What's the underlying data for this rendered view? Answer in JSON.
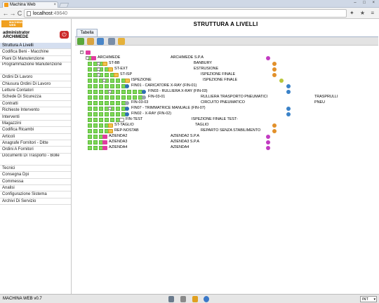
{
  "browser": {
    "tab_title": "Machina Web",
    "close_glyph": "×",
    "window_controls": "– □ ×",
    "back_glyph": "←",
    "forward_glyph": "→",
    "reload_glyph": "C",
    "url_host": "localhost",
    "url_port": ":49640",
    "extension_glyphs": "✦ ★ ≡"
  },
  "app": {
    "logo_text": "MACHINA WEB",
    "user_line1": "administrator",
    "user_line2": "ARCHIMEDE",
    "logout_glyph": "⏻",
    "version": "MACHINA WEB v0.7",
    "language": "INT",
    "language_caret": "▾"
  },
  "menu": [
    "Struttura A Livelli",
    "Codifica Beni - Macchine",
    "Piani Di Manutenzione",
    "Programmazione Manutenzione",
    "Ordini Di Lavoro",
    "Chiusura Ordini Di Lavoro",
    "Letture Contatori",
    "Schede Di Sicurezza",
    "Contratti",
    "Richieste Intervento",
    "Interventi",
    "Magazzini",
    "Codifica Ricambi",
    "Articoli",
    "Anagrafe Fornitori - Ditte",
    "Ordini A Fornitori",
    "Documenti Di Trasporto - Bolle",
    "Tecnici",
    "Consegna Dpi",
    "Commessa",
    "Analisi",
    "Configurazione Sistema",
    "Archivi Di Servizio"
  ],
  "main": {
    "title": "STRUTTURA A LIVELLI",
    "subtab": "Tabella"
  },
  "tree": [
    {
      "code": "",
      "desc": "",
      "extra": "",
      "extra2": "",
      "icon": "mag",
      "dot": ""
    },
    {
      "code": "ARCHIMEDE",
      "desc": "ARCHIMEDE S.P.A",
      "extra": "",
      "extra2": "",
      "icon": "mag",
      "dot": "mag"
    },
    {
      "code": "ST-BB",
      "desc": "BANBURY",
      "extra": "",
      "extra2": "",
      "icon": "yel",
      "dot": "org"
    },
    {
      "code": "ST-EXT",
      "desc": "ESTRUSIONE",
      "extra": "",
      "extra2": "",
      "icon": "yel",
      "dot": "org"
    },
    {
      "code": "ST-ISP",
      "desc": "ISPEZIONE FINALE",
      "extra": "",
      "extra2": "",
      "icon": "yel",
      "dot": "org"
    },
    {
      "code": "ISPEZIONE",
      "desc": "ISPEZIONE FINALE",
      "extra": "",
      "extra2": "",
      "icon": "yel",
      "dot": "grn"
    },
    {
      "code": "FIN01 - CARICATORE X-RAY (FIN-01)",
      "desc": "",
      "extra": "",
      "extra2": "",
      "icon": "blu",
      "dot": "blu"
    },
    {
      "code": "FIN03 - RULLIERA X-RAY (FIN-03)",
      "desc": "",
      "extra": "",
      "extra2": "",
      "icon": "blu",
      "dot": "blu"
    },
    {
      "code": "FIN-03-01",
      "desc": "",
      "extra": "RULLIERA TRASPORTO PNEUMATICI",
      "extra2": "TRASPRULLI",
      "icon": "wrn",
      "dot": ""
    },
    {
      "code": "FIN-03-03",
      "desc": "",
      "extra": "CIRCUITO PNEUMATICO",
      "extra2": "PNEU",
      "icon": "wrn",
      "dot": ""
    },
    {
      "code": "FIN07 - TRIMMATRICE MANUALE (FIN-07)",
      "desc": "",
      "extra": "",
      "extra2": "",
      "icon": "blu",
      "dot": "blu"
    },
    {
      "code": "FIN02 - X-RAY (FIN-02)",
      "desc": "",
      "extra": "",
      "extra2": "",
      "icon": "blu",
      "dot": "blu"
    },
    {
      "code": "FIN-TEST",
      "desc": "ISPEZIONE FINALE TEST-",
      "extra": "",
      "extra2": "",
      "icon": "doc",
      "dot": ""
    },
    {
      "code": "ST-TAGLIO",
      "desc": "TAGLIO",
      "extra": "",
      "extra2": "",
      "icon": "yel",
      "dot": "org"
    },
    {
      "code": "REP-NOSTAB",
      "desc": "REPARTO SENZA STABILIMENTO",
      "extra": "",
      "extra2": "",
      "icon": "yel",
      "dot": "org"
    },
    {
      "code": "AZIENDA2",
      "desc": "AZIENDA2 S.P.A",
      "extra": "",
      "extra2": "",
      "icon": "mag",
      "dot": "mag"
    },
    {
      "code": "AZIENDA3",
      "desc": "AZIENDA3 S.P.A",
      "extra": "",
      "extra2": "",
      "icon": "mag",
      "dot": "mag"
    },
    {
      "code": "AZIENDA4",
      "desc": "AZIENDA4",
      "extra": "",
      "extra2": "",
      "icon": "mag",
      "dot": "mag"
    }
  ],
  "colors": {
    "accent_orange": "#f0a020",
    "logout_red": "#cc2a2a",
    "tree_green": "#7ed957",
    "active_menu": "#d5dff0"
  }
}
